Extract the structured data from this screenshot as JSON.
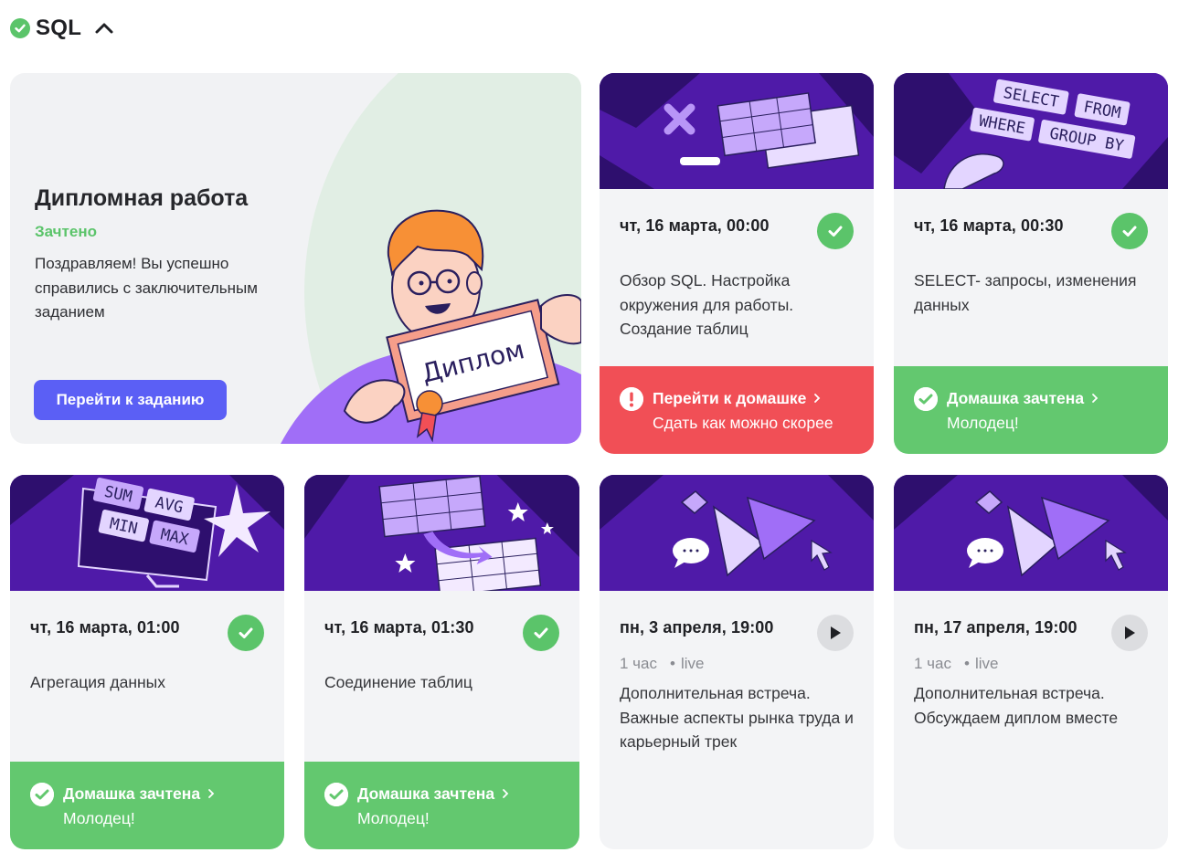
{
  "section": {
    "title": "SQL"
  },
  "diploma": {
    "title": "Дипломная работа",
    "status": "Зачтено",
    "description": "Поздравляем! Вы успешно справились с заключительным заданием",
    "button": "Перейти к заданию",
    "sign_text": "Диплом"
  },
  "lessons": [
    {
      "date": "чт, 16 марта, 00:00",
      "description": "Обзор SQL. Настройка окружения для работы. Создание таблиц",
      "hw_title": "Перейти к домашке",
      "hw_sub": "Сдать как можно скорее"
    },
    {
      "date": "чт, 16 марта, 00:30",
      "description": "SELECT- запросы, изменения данных",
      "hw_title": "Домашка зачтена",
      "hw_sub": "Молодец!",
      "banner_words": [
        "SELECT",
        "FROM",
        "WHERE",
        "GROUP BY"
      ]
    },
    {
      "date": "чт, 16 марта, 01:00",
      "description": "Агрегация данных",
      "hw_title": "Домашка зачтена",
      "hw_sub": "Молодец!",
      "banner_words": [
        "SUM",
        "AVG",
        "MIN",
        "MAX"
      ]
    },
    {
      "date": "чт, 16 марта, 01:30",
      "description": "Соединение таблиц",
      "hw_title": "Домашка зачтена",
      "hw_sub": "Молодец!"
    },
    {
      "date": "пн, 3 апреля, 19:00",
      "duration": "1 час",
      "format": "live",
      "description": "Дополнительная встреча. Важные аспекты рынка труда и карьерный трек"
    },
    {
      "date": "пн, 17 апреля, 19:00",
      "duration": "1 час",
      "format": "live",
      "description": "Дополнительная встреча. Обсуждаем диплом вместе"
    }
  ],
  "colors": {
    "success": "#5bc46a",
    "danger": "#f14f56",
    "primary": "#5b5ff5",
    "banner": "#4f1aa8"
  }
}
